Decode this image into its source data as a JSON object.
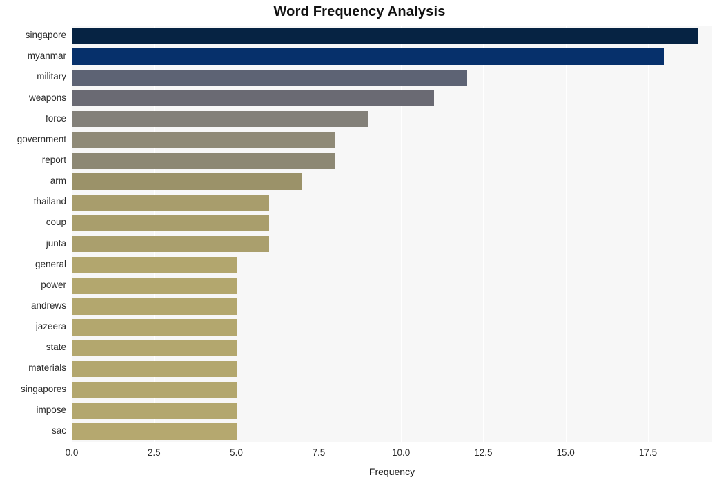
{
  "chart_data": {
    "type": "bar",
    "orientation": "horizontal",
    "title": "Word Frequency Analysis",
    "xlabel": "Frequency",
    "ylabel": "",
    "xlim": [
      0,
      19.45
    ],
    "xticks": [
      0.0,
      2.5,
      5.0,
      7.5,
      10.0,
      12.5,
      15.0,
      17.5
    ],
    "xtick_labels": [
      "0.0",
      "2.5",
      "5.0",
      "7.5",
      "10.0",
      "12.5",
      "15.0",
      "17.5"
    ],
    "grid": true,
    "grid_axis": "x",
    "legend": "none",
    "categories": [
      "singapore",
      "myanmar",
      "military",
      "weapons",
      "force",
      "government",
      "report",
      "arm",
      "thailand",
      "coup",
      "junta",
      "general",
      "power",
      "andrews",
      "jazeera",
      "state",
      "materials",
      "singapores",
      "impose",
      "sac"
    ],
    "values": [
      19,
      18,
      12,
      11,
      9,
      8,
      8,
      7,
      6,
      6,
      6,
      5,
      5,
      5,
      5,
      5,
      5,
      5,
      5,
      5
    ],
    "bar_colors": [
      "#062343",
      "#06306b",
      "#5d6374",
      "#6a6a73",
      "#838079",
      "#8f8a77",
      "#8d8874",
      "#9b9269",
      "#a89d6c",
      "#a99e6c",
      "#aa9f6d",
      "#b2a66e",
      "#b3a76e",
      "#b3a76e",
      "#b3a76e",
      "#b3a76e",
      "#b3a76e",
      "#b3a76e",
      "#b3a76e",
      "#b5a86f"
    ],
    "plot_background": "#f7f7f7",
    "grid_color": "#ffffff",
    "page_background": "#ffffff"
  }
}
